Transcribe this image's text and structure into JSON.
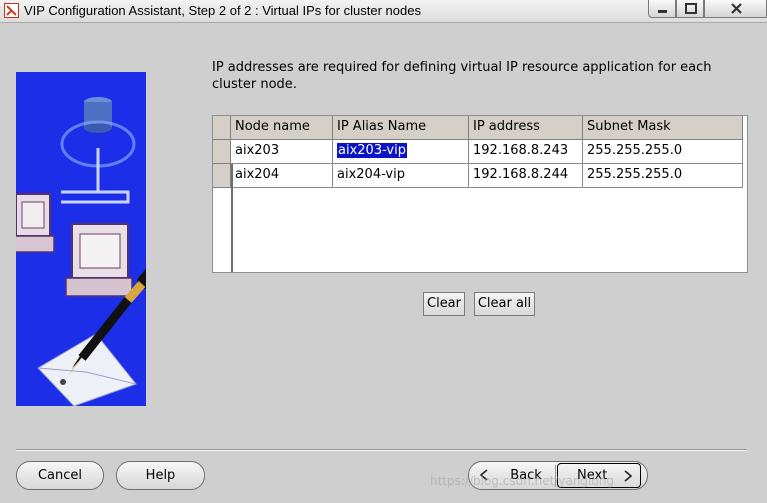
{
  "window": {
    "title": "VIP Configuration Assistant, Step 2 of 2 : Virtual IPs for cluster nodes"
  },
  "intro_text": "IP addresses are required for defining virtual IP resource application for each cluster node.",
  "table": {
    "headers": [
      "Node name",
      "IP Alias Name",
      "IP address",
      "Subnet Mask"
    ],
    "rows": [
      {
        "node": "aix203",
        "alias": "aix203-vip",
        "ip": "192.168.8.243",
        "mask": "255.255.255.0"
      },
      {
        "node": "aix204",
        "alias": "aix204-vip",
        "ip": "192.168.8.244",
        "mask": "255.255.255.0"
      }
    ]
  },
  "buttons": {
    "clear": "Clear",
    "clear_all": "Clear all",
    "cancel": "Cancel",
    "help": "Help",
    "back": "Back",
    "next": "Next"
  },
  "watermark": "https://blog.csdn.net/yanglong",
  "colors": {
    "selection": "#0a14c6",
    "panel_bg": "#cfcfcf",
    "image_bg": "#1c2ee8"
  },
  "icons": {
    "back": "chevron-left-icon",
    "next": "chevron-right-icon",
    "minimize": "minimize-icon",
    "maximize": "maximize-icon",
    "close": "close-icon"
  }
}
